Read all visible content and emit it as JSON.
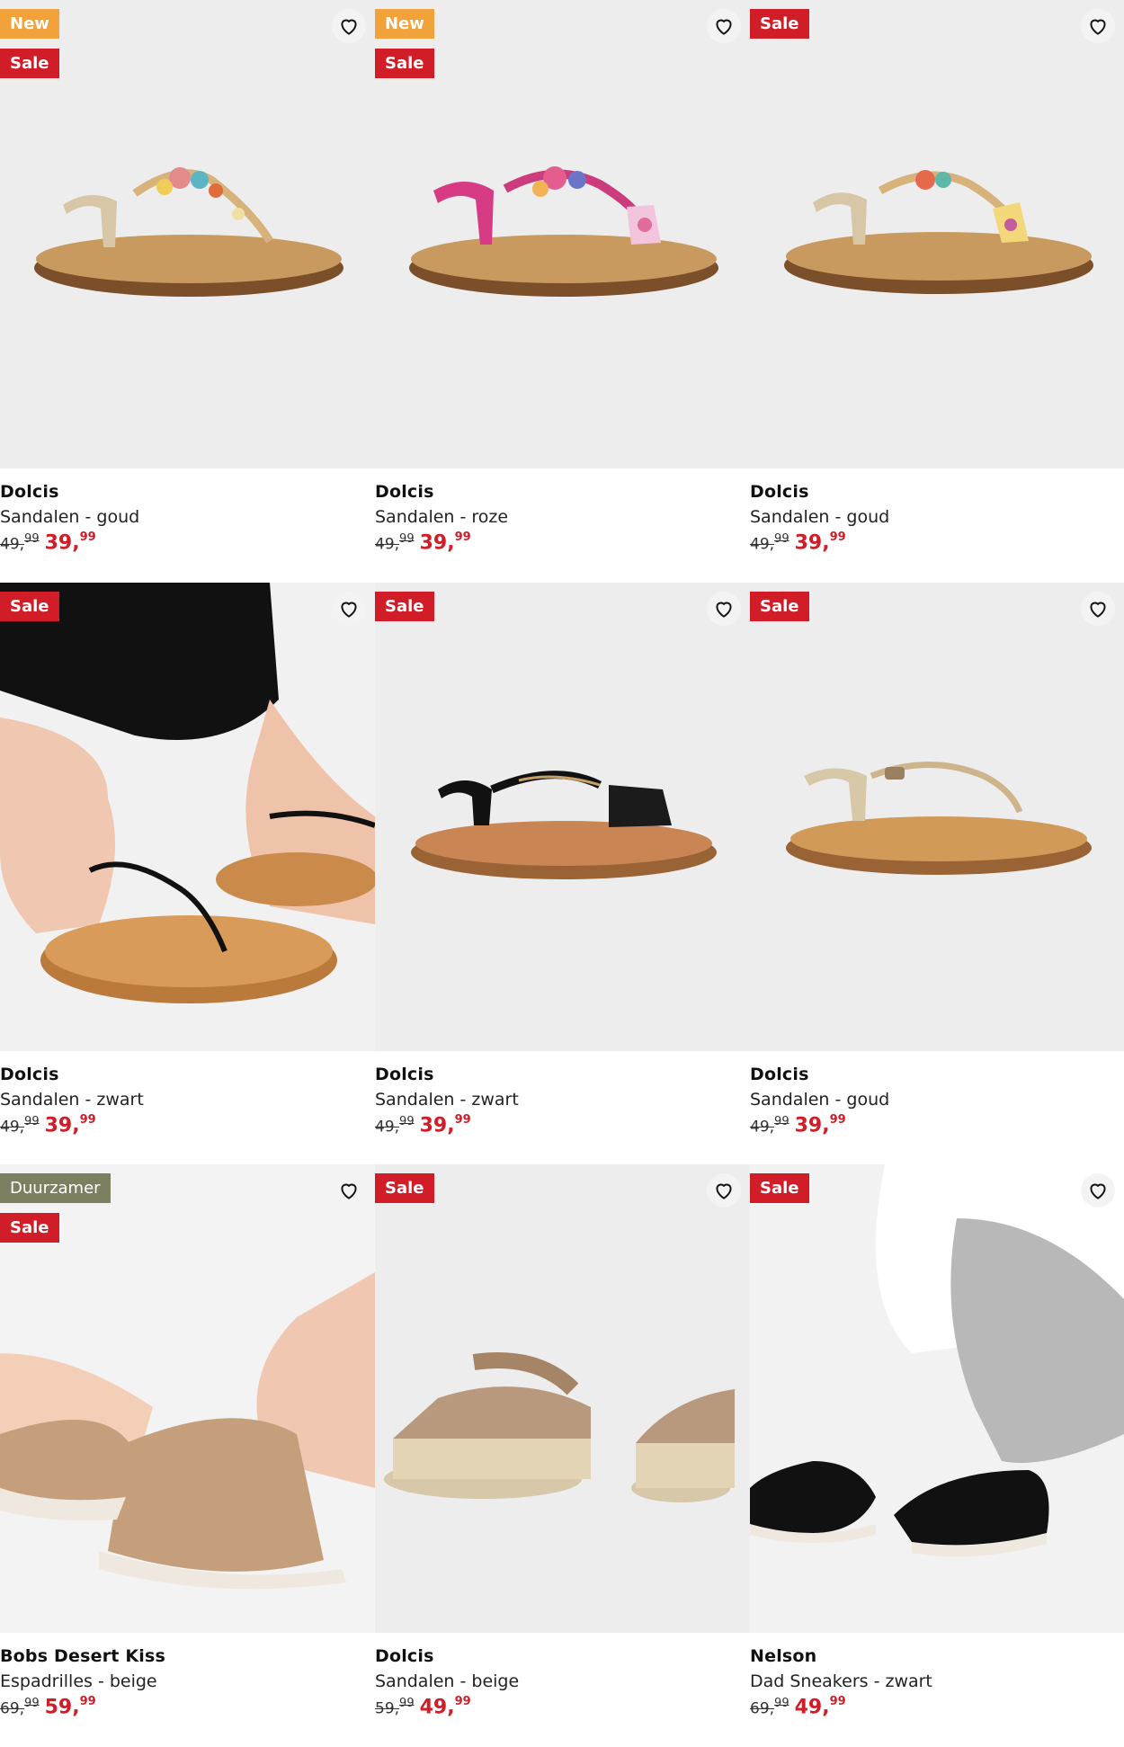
{
  "products": [
    {
      "brand": "Dolcis",
      "subtitle": "Sandalen - goud",
      "price_old_main": "49,",
      "price_old_cents": "99",
      "price_new_main": "39,",
      "price_new_cents": "99",
      "badges": [
        "New",
        "Sale"
      ]
    },
    {
      "brand": "Dolcis",
      "subtitle": "Sandalen - roze",
      "price_old_main": "49,",
      "price_old_cents": "99",
      "price_new_main": "39,",
      "price_new_cents": "99",
      "badges": [
        "New",
        "Sale"
      ]
    },
    {
      "brand": "Dolcis",
      "subtitle": "Sandalen - goud",
      "price_old_main": "49,",
      "price_old_cents": "99",
      "price_new_main": "39,",
      "price_new_cents": "99",
      "badges": [
        "Sale"
      ]
    },
    {
      "brand": "Dolcis",
      "subtitle": "Sandalen - zwart",
      "price_old_main": "49,",
      "price_old_cents": "99",
      "price_new_main": "39,",
      "price_new_cents": "99",
      "badges": [
        "Sale"
      ]
    },
    {
      "brand": "Dolcis",
      "subtitle": "Sandalen - zwart",
      "price_old_main": "49,",
      "price_old_cents": "99",
      "price_new_main": "39,",
      "price_new_cents": "99",
      "badges": [
        "Sale"
      ]
    },
    {
      "brand": "Dolcis",
      "subtitle": "Sandalen - goud",
      "price_old_main": "49,",
      "price_old_cents": "99",
      "price_new_main": "39,",
      "price_new_cents": "99",
      "badges": [
        "Sale"
      ]
    },
    {
      "brand": "Bobs Desert Kiss",
      "subtitle": "Espadrilles - beige",
      "price_old_main": "69,",
      "price_old_cents": "99",
      "price_new_main": "59,",
      "price_new_cents": "99",
      "badges": [
        "Duurzamer",
        "Sale"
      ]
    },
    {
      "brand": "Dolcis",
      "subtitle": "Sandalen - beige",
      "price_old_main": "59,",
      "price_old_cents": "99",
      "price_new_main": "49,",
      "price_new_cents": "99",
      "badges": [
        "Sale"
      ]
    },
    {
      "brand": "Nelson",
      "subtitle": "Dad Sneakers - zwart",
      "price_old_main": "69,",
      "price_old_cents": "99",
      "price_new_main": "49,",
      "price_new_cents": "99",
      "badges": [
        "Sale"
      ]
    }
  ],
  "colors": {
    "sale_badge": "#d11d28",
    "new_badge": "#f2a23a",
    "duurzamer_badge": "#7c8061",
    "sale_price": "#d11d28",
    "image_bg": "#ededed"
  },
  "icons": {
    "favorite": "heart-outline-icon"
  }
}
